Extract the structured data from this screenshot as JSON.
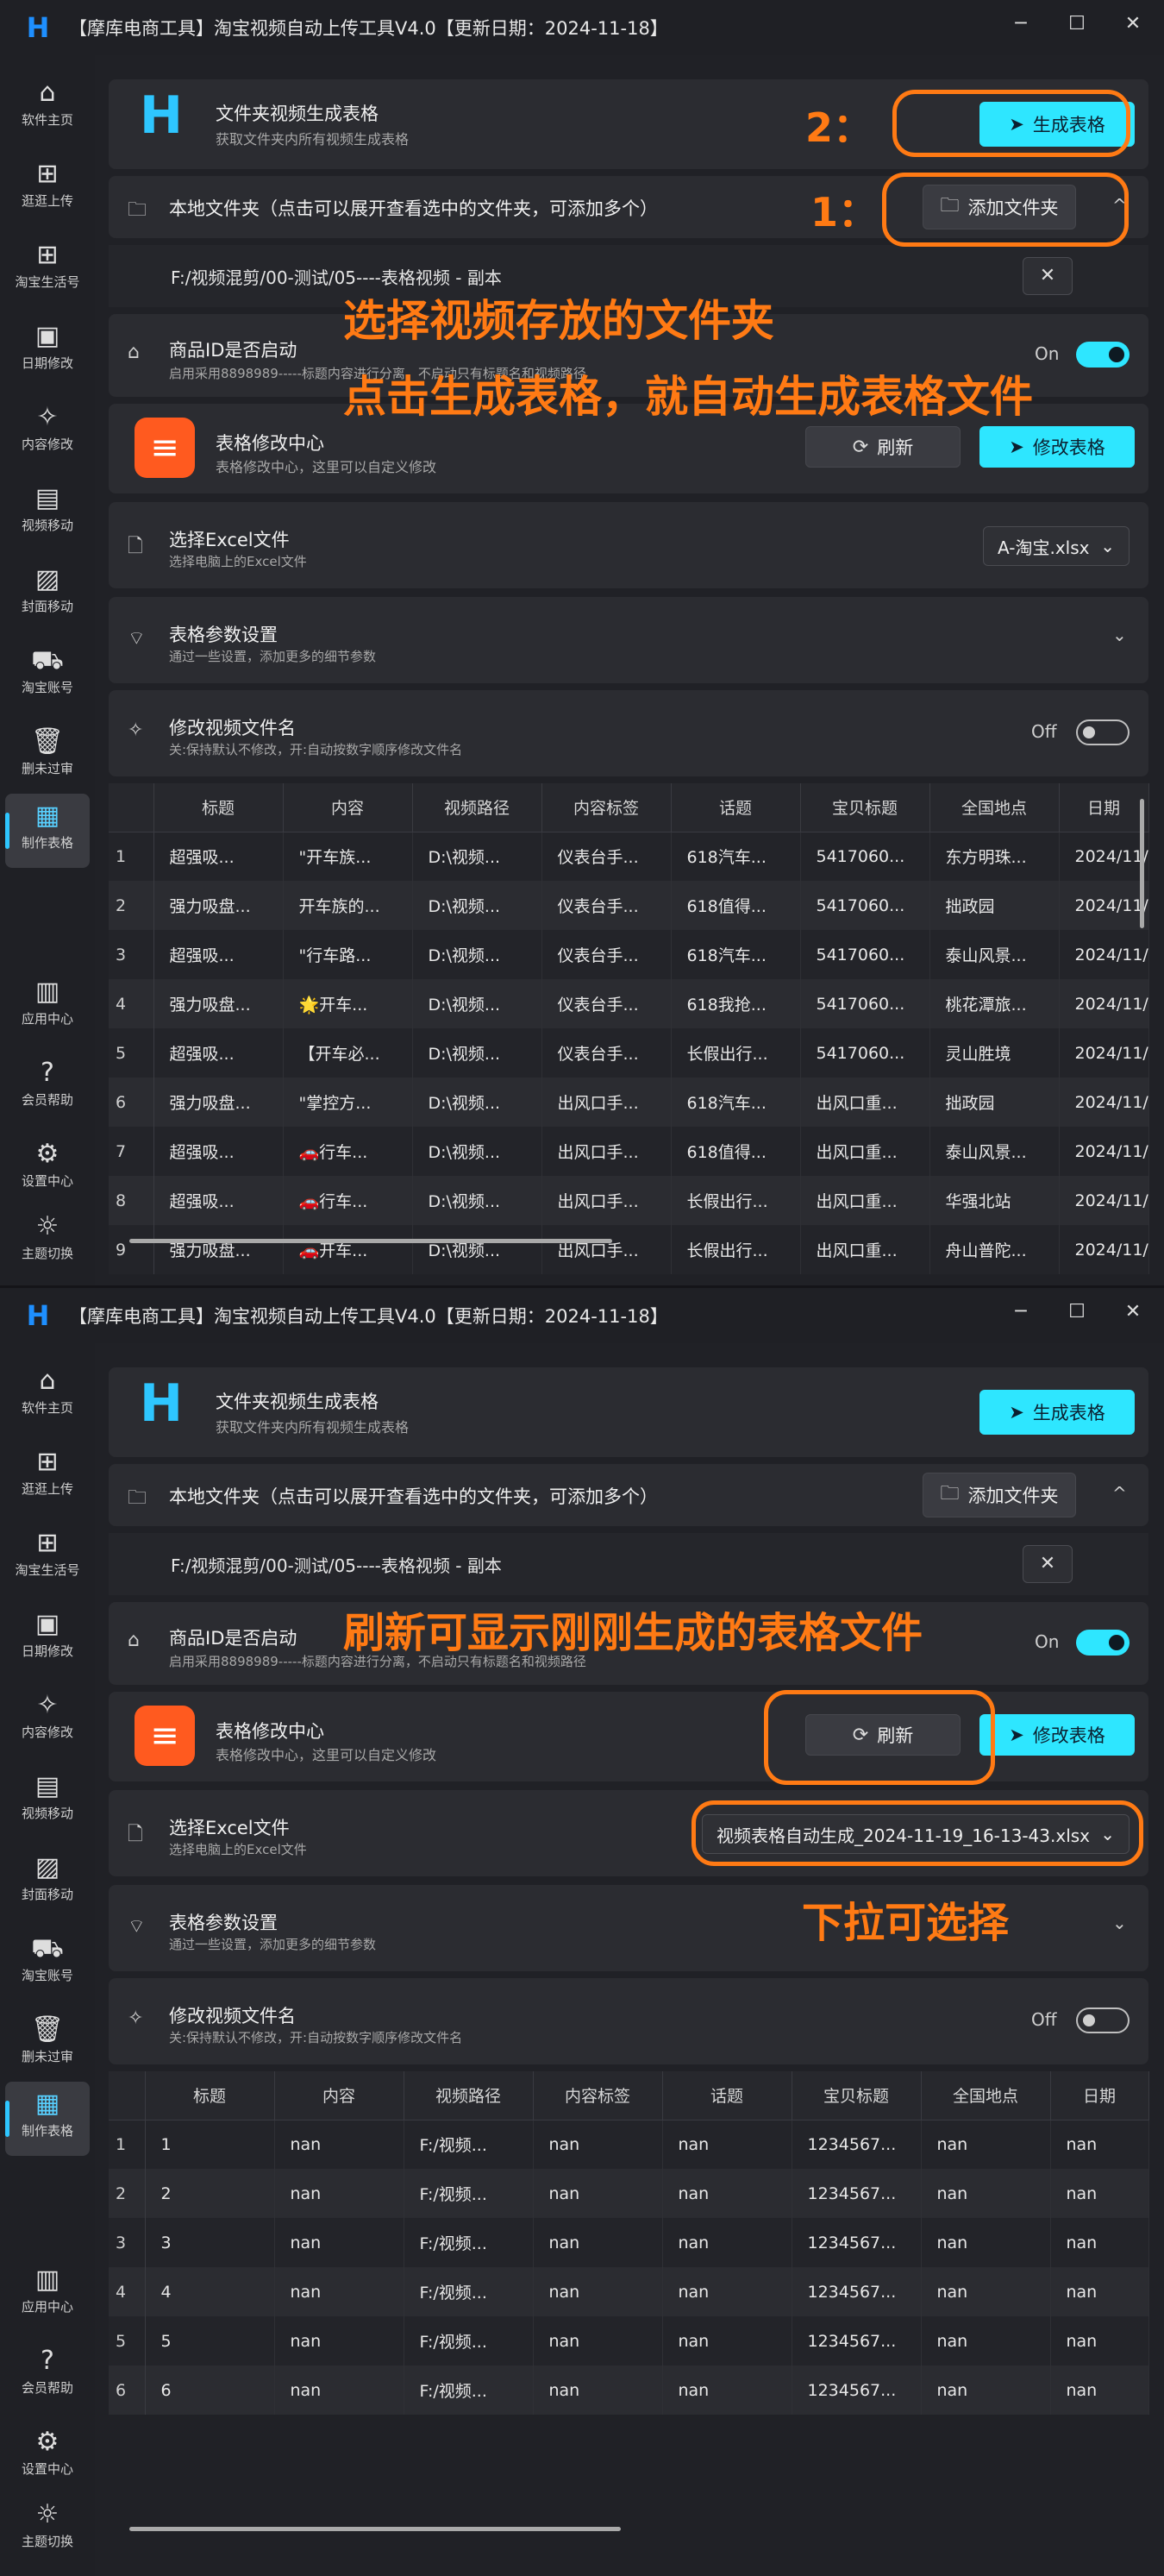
{
  "app": {
    "title": "【摩库电商工具】淘宝视频自动上传工具V4.0【更新日期：2024-11-18】",
    "logo": "H"
  },
  "window_controls": {
    "minimize": "─",
    "maximize": "☐",
    "close": "✕"
  },
  "sidebar": {
    "items": [
      {
        "label": "软件主页",
        "icon": "home-icon",
        "glyph": "⌂"
      },
      {
        "label": "逛逛上传",
        "icon": "grid-add-icon",
        "glyph": "⊞"
      },
      {
        "label": "淘宝生活号",
        "icon": "grid-add-icon",
        "glyph": "⊞"
      },
      {
        "label": "日期修改",
        "icon": "calendar-icon",
        "glyph": "▣"
      },
      {
        "label": "内容修改",
        "icon": "sparkle-icon",
        "glyph": "✧"
      },
      {
        "label": "视频移动",
        "icon": "clapper-icon",
        "glyph": "▤"
      },
      {
        "label": "封面移动",
        "icon": "image-icon",
        "glyph": "▨"
      },
      {
        "label": "淘宝账号",
        "icon": "cart-icon",
        "glyph": "⛟"
      },
      {
        "label": "删未过审",
        "icon": "trash-icon",
        "glyph": "🗑"
      },
      {
        "label": "制作表格",
        "icon": "table-icon",
        "glyph": "▦"
      },
      {
        "label": "应用中心",
        "icon": "books-icon",
        "glyph": "▥"
      },
      {
        "label": "会员帮助",
        "icon": "help-icon",
        "glyph": "?"
      },
      {
        "label": "设置中心",
        "icon": "gear-icon",
        "glyph": "⚙"
      },
      {
        "label": "主题切换",
        "icon": "sun-icon",
        "glyph": "☼"
      }
    ]
  },
  "gen_card": {
    "title": "文件夹视频生成表格",
    "subtitle": "获取文件夹内所有视频生成表格",
    "button": "生成表格",
    "button_icon": "➤"
  },
  "folder_card": {
    "label": "本地文件夹（点击可以展开查看选中的文件夹，可添加多个）",
    "button": "添加文件夹",
    "path": "F:/视频混剪/00-测试/05----表格视频 - 副本",
    "remove": "✕",
    "collapse": "^"
  },
  "goods_card": {
    "title": "商品ID是否启动",
    "subtitle": "启用采用8898989-----标题内容进行分离，不启动只有标题名和视频路径",
    "state": "On"
  },
  "sheet_card": {
    "title": "表格修改中心",
    "subtitle": "表格修改中心，这里可以自定义修改",
    "refresh": "刷新",
    "edit": "修改表格",
    "icon": "≡"
  },
  "excel_card": {
    "title": "选择Excel文件",
    "subtitle": "选择电脑上的Excel文件",
    "value_1": "A-淘宝.xlsx",
    "value_2": "视频表格自动生成_2024-11-19_16-13-43.xlsx"
  },
  "params_card": {
    "title": "表格参数设置",
    "subtitle": "通过一些设置，添加更多的细节参数"
  },
  "rename_card": {
    "title": "修改视频文件名",
    "subtitle": "关:保持默认不修改，开:自动按数字顺序修改文件名",
    "state": "Off"
  },
  "table": {
    "headers": [
      "标题",
      "内容",
      "视频路径",
      "内容标签",
      "话题",
      "宝贝标题",
      "全国地点",
      "日期"
    ],
    "rows_1": [
      [
        "1",
        "超强吸...",
        "\"开车族...",
        "D:\\视频...",
        "仪表台手...",
        "618汽车...",
        "5417060...",
        "东方明珠...",
        "2024/11/"
      ],
      [
        "2",
        "强力吸盘...",
        "开车族的...",
        "D:\\视频...",
        "仪表台手...",
        "618值得...",
        "5417060...",
        "拙政园",
        "2024/11/"
      ],
      [
        "3",
        "超强吸...",
        "\"行车路...",
        "D:\\视频...",
        "仪表台手...",
        "618汽车...",
        "5417060...",
        "泰山风景...",
        "2024/11/"
      ],
      [
        "4",
        "强力吸盘...",
        "🌟开车...",
        "D:\\视频...",
        "仪表台手...",
        "618我抢...",
        "5417060...",
        "桃花潭旅...",
        "2024/11/"
      ],
      [
        "5",
        "超强吸...",
        "【开车必...",
        "D:\\视频...",
        "仪表台手...",
        "长假出行...",
        "5417060...",
        "灵山胜境",
        "2024/11/"
      ],
      [
        "6",
        "强力吸盘...",
        "\"掌控方...",
        "D:\\视频...",
        "出风口手...",
        "618汽车...",
        "出风口重...",
        "拙政园",
        "2024/11/"
      ],
      [
        "7",
        "超强吸...",
        "🚗行车...",
        "D:\\视频...",
        "出风口手...",
        "618值得...",
        "出风口重...",
        "泰山风景...",
        "2024/11/"
      ],
      [
        "8",
        "超强吸...",
        "🚗行车...",
        "D:\\视频...",
        "出风口手...",
        "长假出行...",
        "出风口重...",
        "华强北站",
        "2024/11/"
      ],
      [
        "9",
        "强力吸盘...",
        "🚗开车...",
        "D:\\视频...",
        "出风口手...",
        "长假出行...",
        "出风口重...",
        "舟山普陀...",
        "2024/11/"
      ]
    ],
    "rows_2": [
      [
        "1",
        "1",
        "nan",
        "F:/视频...",
        "nan",
        "nan",
        "1234567...",
        "nan",
        "nan"
      ],
      [
        "2",
        "2",
        "nan",
        "F:/视频...",
        "nan",
        "nan",
        "1234567...",
        "nan",
        "nan"
      ],
      [
        "3",
        "3",
        "nan",
        "F:/视频...",
        "nan",
        "nan",
        "1234567...",
        "nan",
        "nan"
      ],
      [
        "4",
        "4",
        "nan",
        "F:/视频...",
        "nan",
        "nan",
        "1234567...",
        "nan",
        "nan"
      ],
      [
        "5",
        "5",
        "nan",
        "F:/视频...",
        "nan",
        "nan",
        "1234567...",
        "nan",
        "nan"
      ],
      [
        "6",
        "6",
        "nan",
        "F:/视频...",
        "nan",
        "nan",
        "1234567...",
        "nan",
        "nan"
      ]
    ]
  },
  "annotations": {
    "step2": "2：",
    "step1": "1：",
    "line1": "选择视频存放的文件夹",
    "line2": "点击生成表格，就自动生成表格文件",
    "refresh_note": "刷新可显示刚刚生成的表格文件",
    "dropdown_note": "下拉可选择",
    "color": "#ff7a14"
  },
  "colors": {
    "accent": "#2ee6ff",
    "bg": "#202126",
    "card": "#2b2c31",
    "sheet_icon": "#ff5a1f"
  }
}
